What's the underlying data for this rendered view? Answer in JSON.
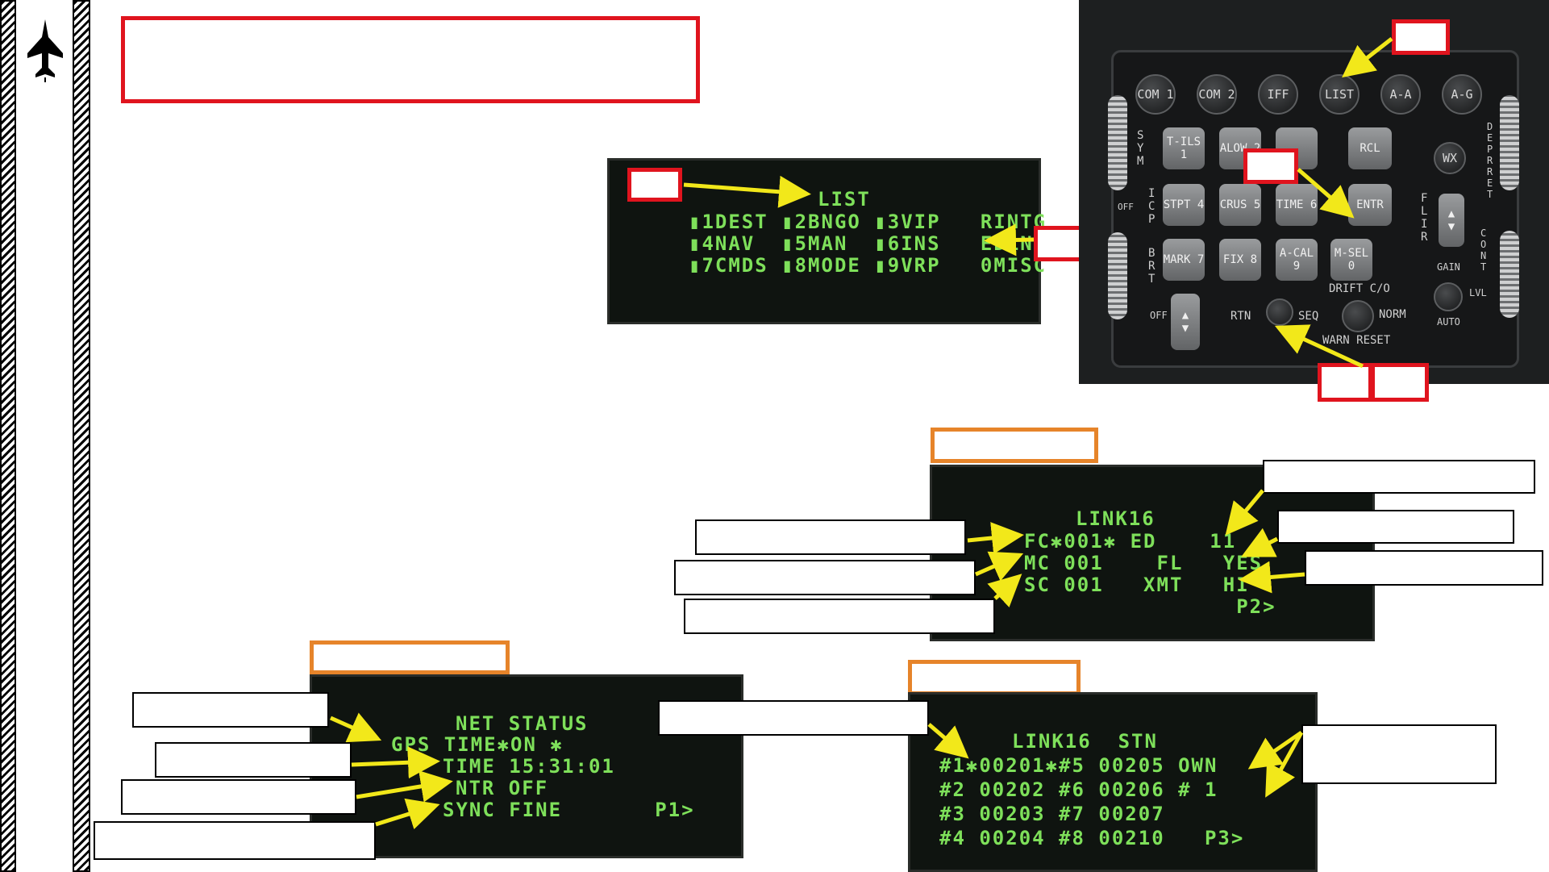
{
  "ded_list": {
    "title": "LIST",
    "rows": [
      "▮1DEST ▮2BNGO ▮3VIP   RINTG",
      "▮4NAV  ▮5MAN  ▮6INS   EDLNK",
      "▮7CMDS ▮8MODE ▮9VRP   0MISC"
    ]
  },
  "ded_link16": {
    "title": "LINK16",
    "rows": [
      "FC✱001✱ ED    11",
      "MC 001    FL   YES",
      "SC 001   XMT   HI",
      "                P2>"
    ]
  },
  "ded_net_status": {
    "title": "NET STATUS",
    "rows": [
      "GPS TIME✱ON ✱",
      "TIME 15:31:01",
      "NTR OFF",
      "SYNC FINE       P1>"
    ]
  },
  "ded_stn": {
    "title": "LINK16  STN",
    "rows": [
      "#1✱00201✱#5 00205 OWN",
      "#2 00202 #6 00206 # 1",
      "#3 00203 #7 00207",
      "#4 00204 #8 00210   P3>"
    ]
  },
  "icp": {
    "top_buttons": [
      "COM 1",
      "COM 2",
      "IFF",
      "LIST",
      "A-A",
      "A-G"
    ],
    "keys": [
      [
        "T-ILS 1",
        "ALOW 2",
        "",
        "RCL"
      ],
      [
        "STPT 4",
        "CRUS 5",
        "TIME 6",
        "ENTR"
      ],
      [
        "MARK 7",
        "FIX 8",
        "A-CAL 9",
        "M-SEL 0"
      ]
    ],
    "wx_button": "WX",
    "labels": {
      "sym": "SYM",
      "icp_brt": "ICP",
      "brt": "BRT",
      "off_top": "OFF",
      "off_bottom": "OFF",
      "rtn": "RTN",
      "seq": "SEQ",
      "drift": "DRIFT C/O",
      "norm": "NORM",
      "warn_reset": "WARN RESET",
      "flir": "FLIR",
      "gain": "GAIN",
      "lvl": "LVL",
      "auto": "AUTO",
      "depr_ret": "DEPR RET",
      "cont": "CONT"
    }
  },
  "colors": {
    "ded_green": "#7ee05a",
    "arrow_yellow": "#f2e81a",
    "red_box": "#e0141e",
    "orange_box": "#e6842a"
  },
  "icons": {
    "logo": "jet-silhouette-icon"
  }
}
